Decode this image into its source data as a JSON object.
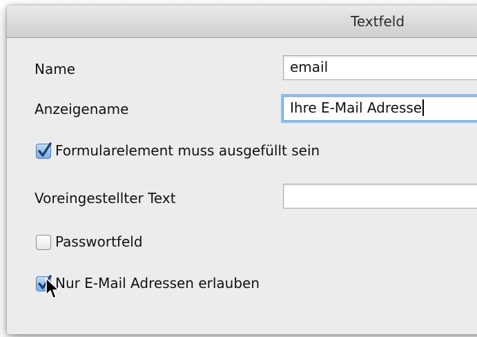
{
  "window": {
    "title": "Textfeld"
  },
  "form": {
    "name_label": "Name",
    "name_value": "email",
    "display_name_label": "Anzeigename",
    "display_name_value": "Ihre E-Mail Adresse",
    "required_label": "Formularelement muss ausgefüllt sein",
    "required_checked": true,
    "default_text_label": "Voreingestellter Text",
    "default_text_value": "",
    "password_label": "Passwortfeld",
    "password_checked": false,
    "email_only_label": "Nur E-Mail Adressen erlauben",
    "email_only_checked": true
  },
  "colors": {
    "window_bg": "#ececec",
    "focus_ring": "#8fc0ee",
    "checkbox_checked": "#78b0e6",
    "checkmark": "#1f3f73"
  }
}
